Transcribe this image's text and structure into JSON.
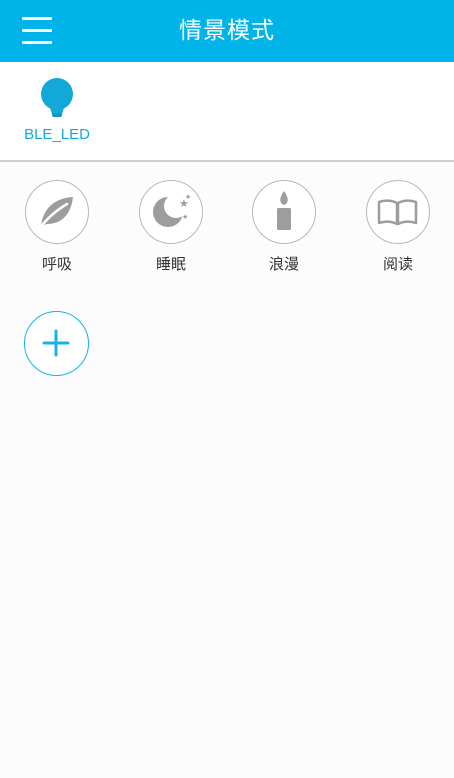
{
  "header": {
    "title": "情景模式",
    "menu_icon": "hamburger-menu-icon",
    "background_color": "#00b4ea"
  },
  "devices": [
    {
      "label": "BLE_LED",
      "icon": "bulb-icon",
      "color": "#12a9d9"
    }
  ],
  "scenes": [
    {
      "label": "呼吸",
      "icon": "leaf-icon"
    },
    {
      "label": "睡眠",
      "icon": "moon-stars-icon"
    },
    {
      "label": "浪漫",
      "icon": "candle-icon"
    },
    {
      "label": "阅读",
      "icon": "book-icon"
    }
  ],
  "add_scene": {
    "icon": "plus-icon",
    "accent_color": "#18b3e3"
  }
}
